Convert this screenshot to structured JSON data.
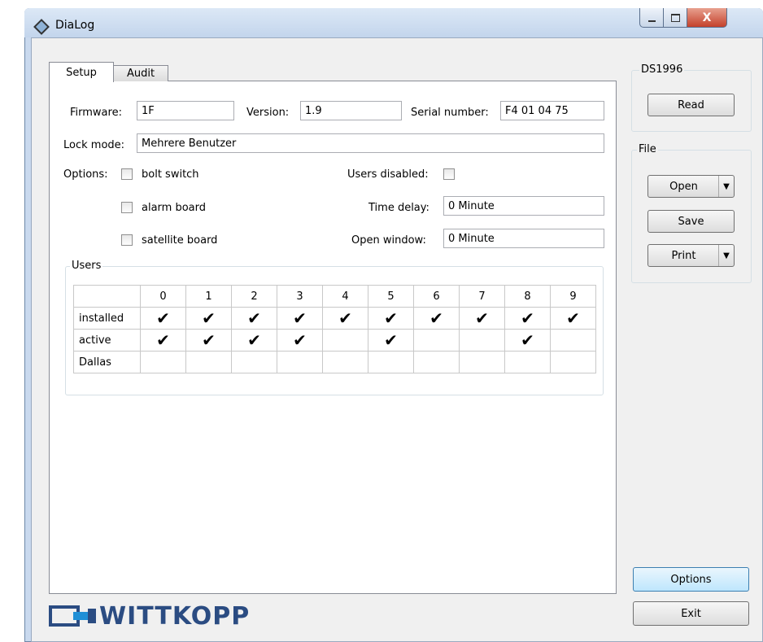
{
  "window": {
    "title": "DiaLog",
    "close_glyph": "X"
  },
  "tabs": {
    "setup": "Setup",
    "audit": "Audit"
  },
  "setup": {
    "firmware_label": "Firmware:",
    "firmware_value": "1F",
    "version_label": "Version:",
    "version_value": "1.9",
    "serial_label": "Serial number:",
    "serial_value": "F4 01 04 75",
    "lockmode_label": "Lock mode:",
    "lockmode_value": "Mehrere Benutzer",
    "options_label": "Options:",
    "options": [
      {
        "label": "bolt switch",
        "checked": false
      },
      {
        "label": "alarm board",
        "checked": false
      },
      {
        "label": "satellite board",
        "checked": false
      }
    ],
    "users_disabled_label": "Users disabled:",
    "time_delay_label": "Time delay:",
    "time_delay_value": "0 Minute",
    "open_window_label": "Open window:",
    "open_window_value": "0 Minute"
  },
  "users": {
    "group_label": "Users",
    "columns": [
      "0",
      "1",
      "2",
      "3",
      "4",
      "5",
      "6",
      "7",
      "8",
      "9"
    ],
    "check_glyph": "✔",
    "rows": [
      {
        "label": "installed",
        "cells": [
          true,
          true,
          true,
          true,
          true,
          true,
          true,
          true,
          true,
          true
        ]
      },
      {
        "label": "active",
        "cells": [
          true,
          true,
          true,
          true,
          false,
          true,
          false,
          false,
          true,
          false
        ]
      },
      {
        "label": "Dallas",
        "cells": [
          false,
          false,
          false,
          false,
          false,
          false,
          false,
          false,
          false,
          false
        ]
      }
    ]
  },
  "sidebar": {
    "ds_group": "DS1996",
    "read_button": "Read",
    "file_group": "File",
    "open_button": "Open",
    "save_button": "Save",
    "print_button": "Print",
    "options_button": "Options",
    "exit_button": "Exit"
  },
  "logo": {
    "text": "WITTKOPP"
  },
  "colors": {
    "accent": "#2b4c82",
    "title_bg": "#dce8f6",
    "close_red": "#c4412b"
  }
}
